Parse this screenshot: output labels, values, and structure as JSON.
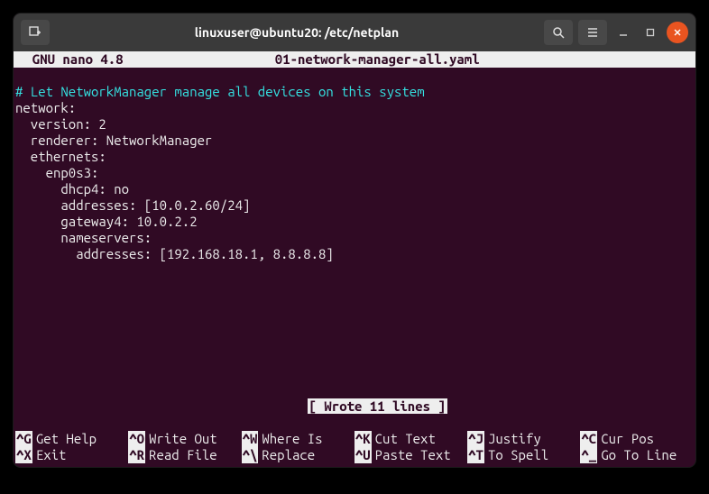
{
  "titlebar": {
    "title": "linuxuser@ubuntu20: /etc/netplan"
  },
  "nano": {
    "app_name": "  GNU nano 4.8",
    "filename": "01-network-manager-all.yaml",
    "status": "[ Wrote 11 lines ]",
    "lines": {
      "comment": "# Let NetworkManager manage all devices on this system",
      "l1": "network:",
      "l2": "  version: 2",
      "l3": "  renderer: NetworkManager",
      "l4": "  ethernets:",
      "l5": "    enp0s3:",
      "l6": "      dhcp4: no",
      "l7": "      addresses: [10.0.2.60/24]",
      "l8": "      gateway4: 10.0.2.2",
      "l9": "      nameservers:",
      "l10": "        addresses: [192.168.18.1, 8.8.8.8]"
    },
    "shortcuts": {
      "row1": [
        {
          "key": "^G",
          "label": "Get Help"
        },
        {
          "key": "^O",
          "label": "Write Out"
        },
        {
          "key": "^W",
          "label": "Where Is"
        },
        {
          "key": "^K",
          "label": "Cut Text"
        },
        {
          "key": "^J",
          "label": "Justify"
        },
        {
          "key": "^C",
          "label": "Cur Pos"
        }
      ],
      "row2": [
        {
          "key": "^X",
          "label": "Exit"
        },
        {
          "key": "^R",
          "label": "Read File"
        },
        {
          "key": "^\\",
          "label": "Replace"
        },
        {
          "key": "^U",
          "label": "Paste Text"
        },
        {
          "key": "^T",
          "label": "To Spell"
        },
        {
          "key": "^_",
          "label": "Go To Line"
        }
      ]
    }
  }
}
